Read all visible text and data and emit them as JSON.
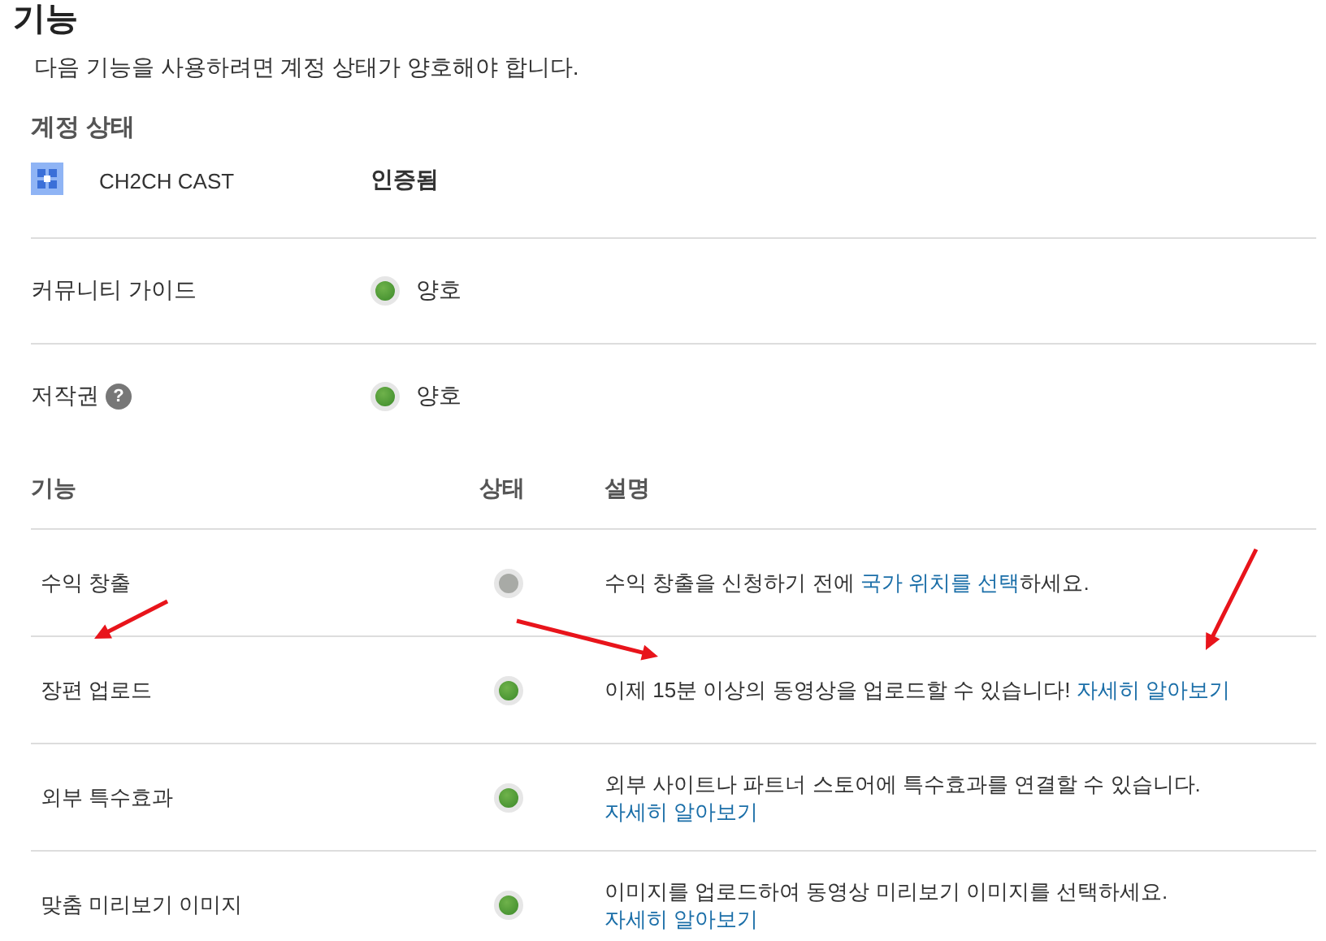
{
  "title": "기능",
  "intro": "다음 기능을 사용하려면 계정 상태가 양호해야 합니다.",
  "account_status": {
    "heading": "계정 상태",
    "channel": {
      "name": "CH2CH CAST",
      "status": "인증됨"
    },
    "items": [
      {
        "label": "커뮤니티 가이드",
        "active": true,
        "status": "양호"
      },
      {
        "label": "저작권",
        "help": "?",
        "active": true,
        "status": "양호"
      }
    ]
  },
  "features": {
    "columns": [
      "기능",
      "상태",
      "설명"
    ],
    "rows": [
      {
        "name": "수익 창출",
        "active": false,
        "description": [
          {
            "text": "수익 창출을 신청하기 전에 ",
            "link": false
          },
          {
            "text": "국가 위치를 선택",
            "link": true
          },
          {
            "text": "하세요.",
            "link": false
          }
        ]
      },
      {
        "name": "장편 업로드",
        "active": true,
        "description": [
          {
            "text": "이제 15분 이상의 동영상을 업로드할 수 있습니다! ",
            "link": false
          },
          {
            "text": "자세히 알아보기",
            "link": true
          }
        ]
      },
      {
        "name": "외부 특수효과",
        "active": true,
        "description": [
          {
            "text": "외부 사이트나 파트너 스토어에 특수효과를 연결할 수 있습니다. ",
            "link": false
          },
          {
            "text": "자세히 알아보기",
            "link": true
          }
        ]
      },
      {
        "name": "맞춤 미리보기 이미지",
        "active": true,
        "description": [
          {
            "text": "이미지를 업로드하여 동영상 미리보기 이미지를 선택하세요. ",
            "link": false
          },
          {
            "text": "자세히 알아보기",
            "link": true
          }
        ]
      }
    ]
  },
  "annotation_arrows": [
    {
      "kind": "arrow"
    },
    {
      "kind": "arrow"
    },
    {
      "kind": "arrow"
    }
  ]
}
